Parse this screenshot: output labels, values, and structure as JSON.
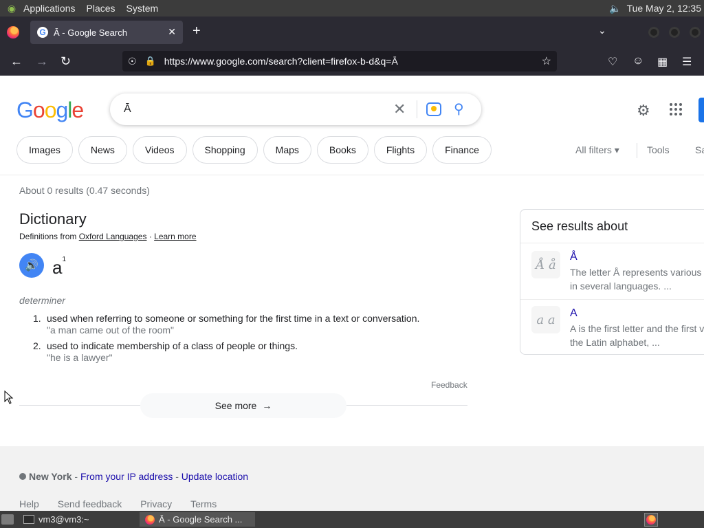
{
  "system_panel": {
    "menus": [
      "Applications",
      "Places",
      "System"
    ],
    "clock": "Tue May  2, 12:35"
  },
  "browser": {
    "tab_title": "Ā - Google Search",
    "url": "https://www.google.com/search?client=firefox-b-d&q=Ā"
  },
  "google": {
    "logo_letters": [
      {
        "ch": "G",
        "color": "#4285f4"
      },
      {
        "ch": "o",
        "color": "#ea4335"
      },
      {
        "ch": "o",
        "color": "#fbbc04"
      },
      {
        "ch": "g",
        "color": "#4285f4"
      },
      {
        "ch": "l",
        "color": "#34a853"
      },
      {
        "ch": "e",
        "color": "#ea4335"
      }
    ],
    "query": "Ā",
    "chips": [
      "Images",
      "News",
      "Videos",
      "Shopping",
      "Maps",
      "Books",
      "Flights",
      "Finance"
    ],
    "all_filters": "All filters",
    "tools": "Tools",
    "safe": "Sa",
    "stats": "About 0 results (0.47 seconds)"
  },
  "dictionary": {
    "title": "Dictionary",
    "source_prefix": "Definitions from",
    "source_name": "Oxford Languages",
    "separator": "·",
    "learn_more": "Learn more",
    "headword": "a",
    "headword_sup": "1",
    "part_of_speech": "determiner",
    "definitions": [
      {
        "num": "1.",
        "text": "used when referring to someone or something for the first time in a text or conversation.",
        "example": "\"a man came out of the room\""
      },
      {
        "num": "2.",
        "text": "used to indicate membership of a class of people or things.",
        "example": "\"he is a lawyer\""
      }
    ],
    "feedback": "Feedback",
    "see_more": "See more"
  },
  "see_results": {
    "title": "See results about",
    "items": [
      {
        "link": "Å",
        "desc1": "The letter Å represents various",
        "desc2": "in several languages. ...",
        "thumb": "Å å"
      },
      {
        "link": "A",
        "desc1": "A is the first letter and the first v",
        "desc2": "the Latin alphabet, ...",
        "thumb": "a a"
      }
    ]
  },
  "footer": {
    "location": "New York",
    "sep1": " - ",
    "from_ip": "From your IP address",
    "sep2": " - ",
    "update": "Update location",
    "links": [
      "Help",
      "Send feedback",
      "Privacy",
      "Terms"
    ]
  },
  "taskbar": {
    "terminal": "vm3@vm3:~",
    "firefox": "Ā - Google Search ..."
  },
  "colors": {
    "link_blue": "#1a0dab",
    "google_blue": "#4285f4",
    "panel_bg": "#3c3c3c",
    "firefox_chrome": "#2b2a33"
  },
  "icons": {
    "search": "magnifier-icon",
    "settings": "gear-icon",
    "apps": "grid-icon"
  }
}
